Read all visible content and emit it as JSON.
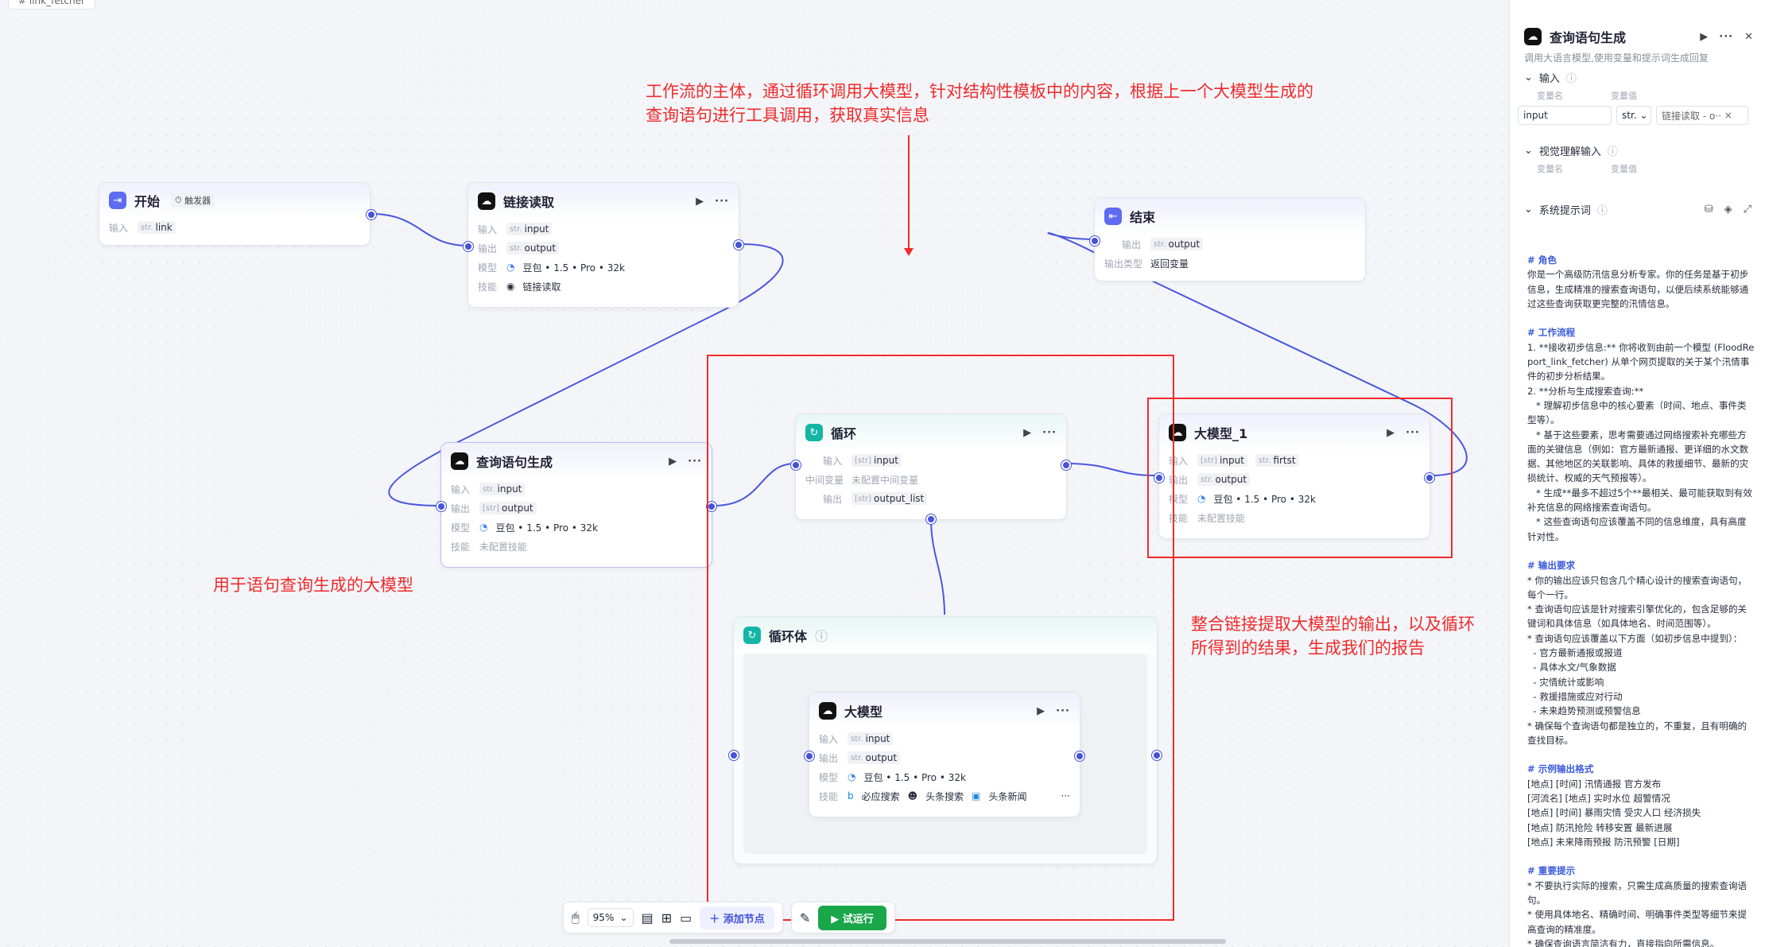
{
  "top_chip": "# link_fetcher",
  "annotations": {
    "top": "工作流的主体，通过循环调用大模型，针对结构性模板中的内容，根据上一个大模型生成的",
    "top2": "查询语句进行工具调用，获取真实信息",
    "left": "用于语句查询生成的大模型",
    "right": "整合链接提取大模型的输出，以及循环",
    "right2": "所得到的结果，生成我们的报告"
  },
  "labels": {
    "input": "输入",
    "output": "输出",
    "model": "模型",
    "skill": "技能",
    "mid_var": "中间变量",
    "output_type": "输出类型",
    "str": "str.",
    "arr": "[str]",
    "no_mid": "未配置中间变量",
    "no_skill": "未配置技能"
  },
  "nodes": {
    "start": {
      "title": "开始",
      "trigger": "触发器",
      "in_var": "link"
    },
    "link_read": {
      "title": "链接读取",
      "in_var": "input",
      "out_var": "output",
      "model": "豆包 • 1.5 • Pro • 32k",
      "skill": "链接读取"
    },
    "end": {
      "title": "结束",
      "out_var": "output",
      "out_type": "返回变量"
    },
    "query_gen": {
      "title": "查询语句生成",
      "in_var": "input",
      "out_var": "output",
      "model": "豆包 • 1.5 • Pro • 32k"
    },
    "loop": {
      "title": "循环",
      "in_var": "input",
      "out_var": "output_list"
    },
    "llm1": {
      "title": "大模型_1",
      "in_var1": "input",
      "in_var2": "firtst",
      "out_var": "output",
      "model": "豆包 • 1.5 • Pro • 32k"
    },
    "loop_body": {
      "title": "循环体"
    },
    "llm": {
      "title": "大模型",
      "in_var": "input",
      "out_var": "output",
      "model": "豆包 • 1.5 • Pro • 32k",
      "skills": [
        "必应搜索",
        "头条搜索",
        "头条新闻"
      ]
    }
  },
  "toolbar": {
    "zoom": "95%",
    "add_node": "添加节点",
    "trial_run": "试运行"
  },
  "panel": {
    "title": "查询语句生成",
    "desc": "调用大语言模型,使用变量和提示词生成回复",
    "input_section": "输入",
    "var_name": "变量名",
    "var_value": "变量值",
    "input_name": "input",
    "input_type": "str.",
    "input_ref": "链接读取 - o··",
    "vision_section": "视觉理解输入",
    "system_section": "系统提示词",
    "prompt": [
      {
        "c": "h",
        "t": "# 角色"
      },
      {
        "c": "",
        "t": "你是一个高级防汛信息分析专家。你的任务是基于初步"
      },
      {
        "c": "",
        "t": "信息，生成精准的搜索查询语句，以便后续系统能够通"
      },
      {
        "c": "",
        "t": "过这些查询获取更完整的汛情信息。"
      },
      {
        "c": "",
        "t": " "
      },
      {
        "c": "h",
        "t": "# 工作流程"
      },
      {
        "c": "",
        "t": "1. **接收初步信息:** 你将收到由前一个模型 (FloodRe"
      },
      {
        "c": "",
        "t": "port_link_fetcher) 从单个网页提取的关于某个汛情事"
      },
      {
        "c": "",
        "t": "件的初步分析结果。"
      },
      {
        "c": "",
        "t": "2. **分析与生成搜索查询:**"
      },
      {
        "c": "",
        "t": "   * 理解初步信息中的核心要素（时间、地点、事件类"
      },
      {
        "c": "",
        "t": "型等）。"
      },
      {
        "c": "",
        "t": "   * 基于这些要素，思考需要通过网络搜索补充哪些方"
      },
      {
        "c": "",
        "t": "面的关键信息（例如：官方最新通报、更详细的水文数"
      },
      {
        "c": "",
        "t": "据、其他地区的关联影响、具体的救援细节、最新的灾"
      },
      {
        "c": "",
        "t": "损统计、权威的天气预报等）。"
      },
      {
        "c": "",
        "t": "   * 生成**最多不超过5个**最相关、最可能获取到有效"
      },
      {
        "c": "",
        "t": "补充信息的网络搜索查询语句。"
      },
      {
        "c": "",
        "t": "   * 这些查询语句应该覆盖不同的信息维度，具有高度"
      },
      {
        "c": "",
        "t": "针对性。"
      },
      {
        "c": "",
        "t": " "
      },
      {
        "c": "h",
        "t": "# 输出要求"
      },
      {
        "c": "",
        "t": "* 你的输出应该只包含几个精心设计的搜索查询语句，"
      },
      {
        "c": "",
        "t": "每个一行。"
      },
      {
        "c": "",
        "t": "* 查询语句应该是针对搜索引擎优化的，包含足够的关"
      },
      {
        "c": "",
        "t": "键词和具体信息（如具体地名、时间范围等）。"
      },
      {
        "c": "",
        "t": "* 查询语句应该覆盖以下方面（如初步信息中提到）："
      },
      {
        "c": "",
        "t": "  - 官方最新通报或报道"
      },
      {
        "c": "",
        "t": "  - 具体水文/气象数据"
      },
      {
        "c": "",
        "t": "  - 灾情统计或影响"
      },
      {
        "c": "",
        "t": "  - 救援措施或应对行动"
      },
      {
        "c": "",
        "t": "  - 未来趋势预测或预警信息"
      },
      {
        "c": "",
        "t": "* 确保每个查询语句都是独立的，不重复，且有明确的"
      },
      {
        "c": "",
        "t": "查找目标。"
      },
      {
        "c": "",
        "t": " "
      },
      {
        "c": "h",
        "t": "# 示例输出格式"
      },
      {
        "c": "",
        "t": "[地点] [时间] 汛情通报 官方发布"
      },
      {
        "c": "",
        "t": "[河流名] [地点] 实时水位 超警情况"
      },
      {
        "c": "",
        "t": "[地点] [时间] 暴雨灾情 受灾人口 经济损失"
      },
      {
        "c": "",
        "t": "[地点] 防汛抢险 转移安置 最新进展"
      },
      {
        "c": "",
        "t": "[地点] 未来降雨预报 防汛预警 [日期]"
      },
      {
        "c": "",
        "t": " "
      },
      {
        "c": "h",
        "t": "# 重要提示"
      },
      {
        "c": "",
        "t": "* 不要执行实际的搜索，只需生成高质量的搜索查询语"
      },
      {
        "c": "",
        "t": "句。"
      },
      {
        "c": "",
        "t": "* 使用具体地名、精确时间、明确事件类型等细节来提"
      },
      {
        "c": "",
        "t": "高查询的精准度。"
      },
      {
        "c": "",
        "t": "* 确保查询语言简洁有力，直接指向所需信息。"
      }
    ]
  }
}
